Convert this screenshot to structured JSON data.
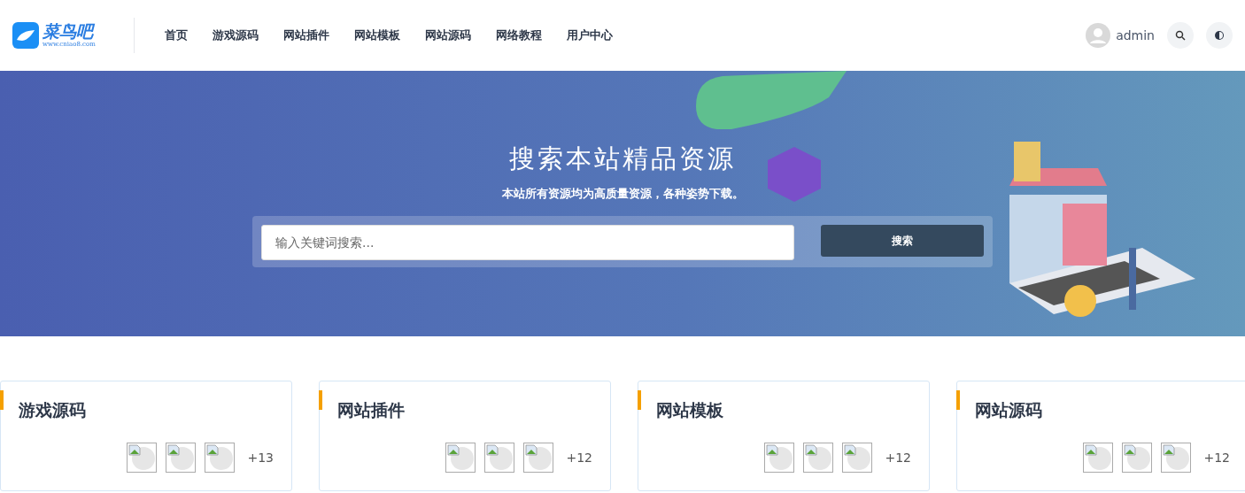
{
  "logo": {
    "name": "菜鸟吧",
    "url": "www.cniao8.com"
  },
  "nav": [
    "首页",
    "游戏源码",
    "网站插件",
    "网站模板",
    "网站源码",
    "网络教程",
    "用户中心"
  ],
  "user": {
    "name": "admin"
  },
  "hero": {
    "title": "搜索本站精品资源",
    "subtitle": "本站所有资源均为高质量资源，各种姿势下载。",
    "search": {
      "placeholder": "输入关键词搜索...",
      "button": "搜索"
    }
  },
  "categories": [
    {
      "title": "游戏源码",
      "count": "+13"
    },
    {
      "title": "网站插件",
      "count": "+12"
    },
    {
      "title": "网站模板",
      "count": "+12"
    },
    {
      "title": "网站源码",
      "count": "+12"
    }
  ]
}
